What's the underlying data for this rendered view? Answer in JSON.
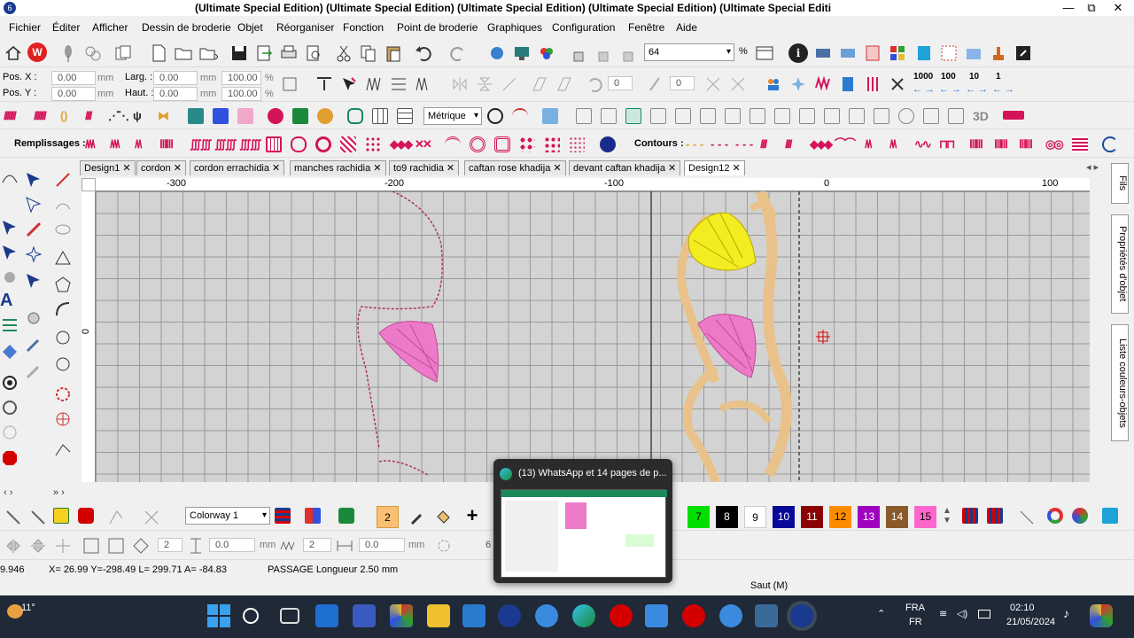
{
  "titlebar": {
    "title": "(Ultimate Special Edition) (Ultimate Special Edition) (Ultimate Special Edition) (Ultimate Special Edition) (Ultimate Special Editi",
    "min": "—",
    "restore": "⧉",
    "close": "✕"
  },
  "menu": [
    "Fichier",
    "Éditer",
    "Afficher",
    "Dessin de broderie",
    "Objet",
    "Réorganiser",
    "Fonction",
    "Point de broderie",
    "Graphiques",
    "Configuration",
    "Fenêtre",
    "Aide"
  ],
  "toolbar": {
    "zoom_value": "64",
    "zoom_unit": "%"
  },
  "position": {
    "pos_x_label": "Pos. X :",
    "pos_x": "0.00",
    "pos_y_label": "Pos. Y :",
    "pos_y": "0.00",
    "larg_label": "Larg. :",
    "larg": "0.00",
    "haut_label": "Haut. :",
    "haut": "0.00",
    "mm": "mm",
    "pct_w": "100.00",
    "pct_h": "100.00",
    "pct": "%",
    "rot1": "0",
    "rot2": "0",
    "num_tools": [
      "1000",
      "100",
      "10",
      "1"
    ]
  },
  "units_combo": "Métrique",
  "fills_label": "Remplissages :",
  "contours_label": "Contours :",
  "tabs": [
    "Design1",
    "cordon",
    "cordon errachidia",
    "manches rachidia",
    "to9 rachidia",
    "caftan rose khadija",
    "devant caftan khadija",
    "Design12"
  ],
  "ruler": {
    "ticks": [
      "-300",
      "-200",
      "-100",
      "0",
      "100"
    ],
    "left_tick": "0"
  },
  "right_dock": {
    "fils": "Fils",
    "props": "Propriétés d'objet",
    "colors": "Liste couleurs-objets"
  },
  "colorway": "Colorway 1",
  "color_cells": [
    {
      "n": "2",
      "bg": "#fbbf74",
      "fg": "#000"
    },
    {
      "n": "7",
      "bg": "#00e000",
      "fg": "#000"
    },
    {
      "n": "8",
      "bg": "#000000",
      "fg": "#fff"
    },
    {
      "n": "9",
      "bg": "#ffffff",
      "fg": "#000"
    },
    {
      "n": "10",
      "bg": "#0a0a9a",
      "fg": "#fff"
    },
    {
      "n": "11",
      "bg": "#8b0000",
      "fg": "#fff"
    },
    {
      "n": "12",
      "bg": "#ff8c00",
      "fg": "#000"
    },
    {
      "n": "13",
      "bg": "#a000c0",
      "fg": "#fff"
    },
    {
      "n": "14",
      "bg": "#8b5a2b",
      "fg": "#fff"
    },
    {
      "n": "15",
      "bg": "#ff66cc",
      "fg": "#000"
    }
  ],
  "params": {
    "v2": "2",
    "v00": "0.0",
    "mm": "mm",
    "v2b": "2",
    "v00b": "0.0",
    "mm2": "mm",
    "six": "6"
  },
  "status": {
    "left": "9.946",
    "coords": "X= 26.99 Y=-298.49 L= 299.71 A= -84.83",
    "passage": "PASSAGE Longueur  2.50 mm",
    "saut": "Saut (M)"
  },
  "popup": {
    "title": "(13) WhatsApp et 14 pages de p..."
  },
  "taskbar": {
    "weather": "11°",
    "lang1": "FRA",
    "lang2": "FR",
    "time": "02:10",
    "date": "21/05/2024"
  }
}
